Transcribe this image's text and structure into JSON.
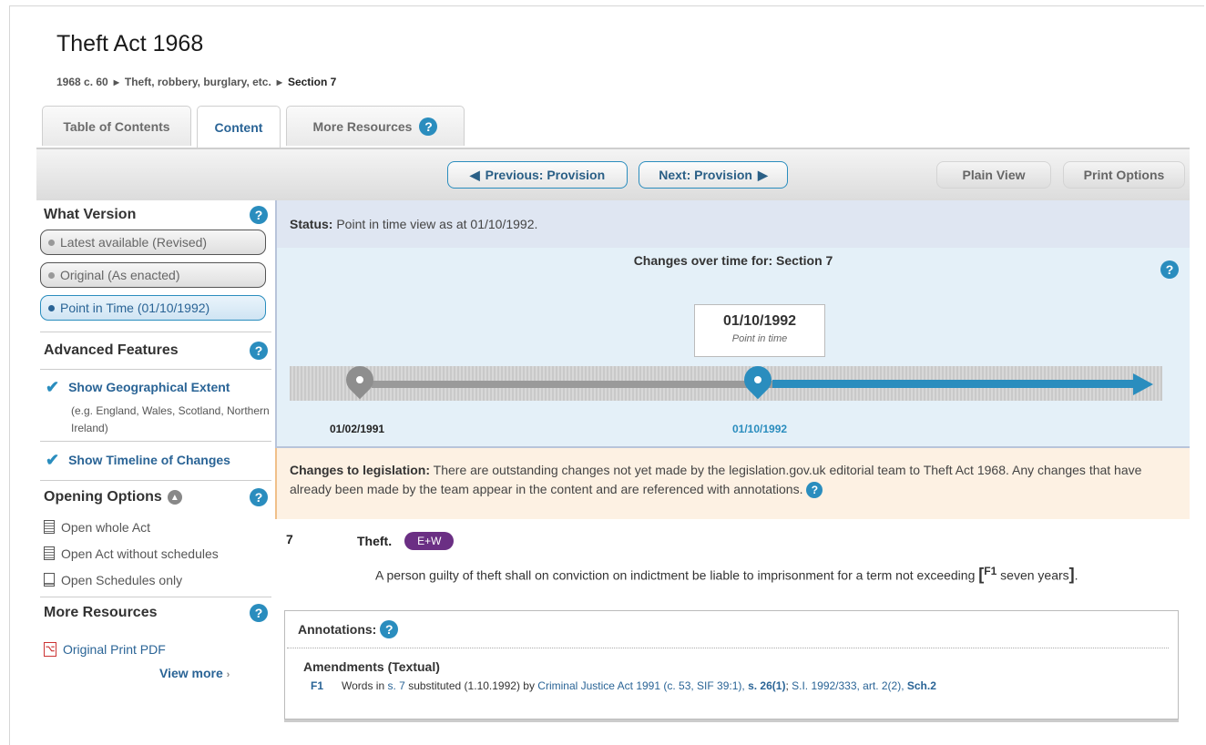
{
  "page": {
    "title": "Theft Act 1968",
    "breadcrumb": [
      "1968 c. 60",
      "Theft, robbery, burglary, etc.",
      "Section 7"
    ]
  },
  "tabs": [
    {
      "label": "Table of Contents",
      "active": false
    },
    {
      "label": "Content",
      "active": true
    },
    {
      "label": "More Resources",
      "active": false,
      "icon": "help-icon"
    }
  ],
  "toolbar": {
    "prev_label": "Previous: Provision",
    "next_label": "Next: Provision",
    "plain_label": "Plain View",
    "print_label": "Print Options"
  },
  "sidebar": {
    "what_version": {
      "heading": "What Version",
      "options": [
        {
          "label": "Latest available (Revised)",
          "active": false
        },
        {
          "label": "Original (As enacted)",
          "active": false
        },
        {
          "label": "Point in Time (01/10/1992)",
          "active": true
        }
      ]
    },
    "advanced": {
      "heading": "Advanced Features",
      "geo_label": "Show Geographical Extent",
      "geo_hint": "(e.g. England, Wales, Scotland, Northern Ireland)",
      "timeline_label": "Show Timeline of Changes"
    },
    "opening": {
      "heading": "Opening Options",
      "items": [
        "Open whole Act",
        "Open Act without schedules",
        "Open Schedules only"
      ]
    },
    "more": {
      "heading": "More Resources",
      "pdf_label": "Original Print PDF",
      "view_more": "View more"
    }
  },
  "status": {
    "label": "Status:",
    "text": "Point in time view as at 01/10/1992."
  },
  "timeline": {
    "title": "Changes over time for: Section 7",
    "callout_date": "01/10/1992",
    "callout_sub": "Point in time",
    "dates": [
      "01/02/1991",
      "01/10/1992"
    ]
  },
  "changes": {
    "label": "Changes to legislation:",
    "text": "There are outstanding changes not yet made by the legislation.gov.uk editorial team to Theft Act 1968. Any changes that have already been made by the team appear in the content and are referenced with annotations."
  },
  "section": {
    "number": "7",
    "title": "Theft.",
    "badge": "E+W",
    "text_before": "A person guilty of theft shall on conviction on indictment be liable to imprisonment for a term not exceeding",
    "open_bracket": "[",
    "ref": "F1",
    "inserted": "seven years",
    "close_bracket": "]",
    "end": "."
  },
  "annotations": {
    "heading": "Annotations:",
    "subheading": "Amendments (Textual)",
    "row": {
      "ref": "F1",
      "t1": "Words in",
      "l1": "s. 7",
      "t2": "substituted (1.10.1992) by",
      "l2": "Criminal Justice Act 1991 (c. 53, SIF 39:1),",
      "l3": "s. 26(1)",
      "t3": ";",
      "l4": "S.I. 1992/333, art. 2(2),",
      "l5": "Sch.2"
    }
  },
  "colors": {
    "accent": "#2a8dbe",
    "link": "#2a6496",
    "badge": "#6b2f84",
    "status_bg": "#dfe6f2",
    "timeline_bg": "#e4f0f8",
    "changes_bg": "#fdf1e3"
  }
}
